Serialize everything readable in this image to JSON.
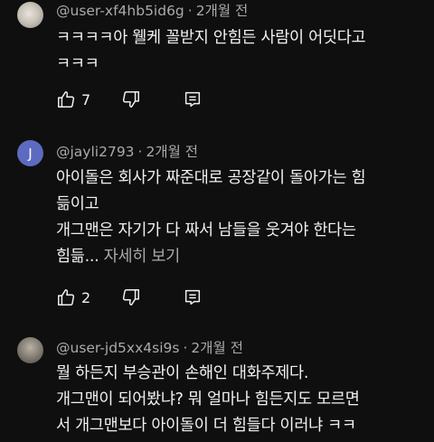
{
  "comments": [
    {
      "handle": "@user-xf4hb5id6g",
      "time": "2개월 전",
      "text": "ㅋㅋㅋㅋ아 웰케 꼴받지 안힘든 사람이 어딧다고\nㅋㅋㅋ",
      "likes": "7",
      "more_label": ""
    },
    {
      "avatar_letter": "J",
      "handle": "@jayli2793",
      "time": "2개월 전",
      "text": "아이돌은 회사가 짜준대로 공장같이 돌아가는 힘\n듦이고\n개그맨은 자기가 다 짜서 남들을 웃겨야 한다는\n힘듦...",
      "more_label": "자세히 보기",
      "likes": "2"
    },
    {
      "handle": "@user-jd5xx4si9s",
      "time": "2개월 전",
      "text": "뭘 하든지 부승관이 손해인 대화주제다.\n개그맨이 되어봤냐? 뭐 얼마나 힘든지도 모르면\n서 개그맨보다 아이돌이 더 힘들다 이러냐 ㅋㅋ",
      "more_label": ""
    }
  ],
  "separator": "·"
}
